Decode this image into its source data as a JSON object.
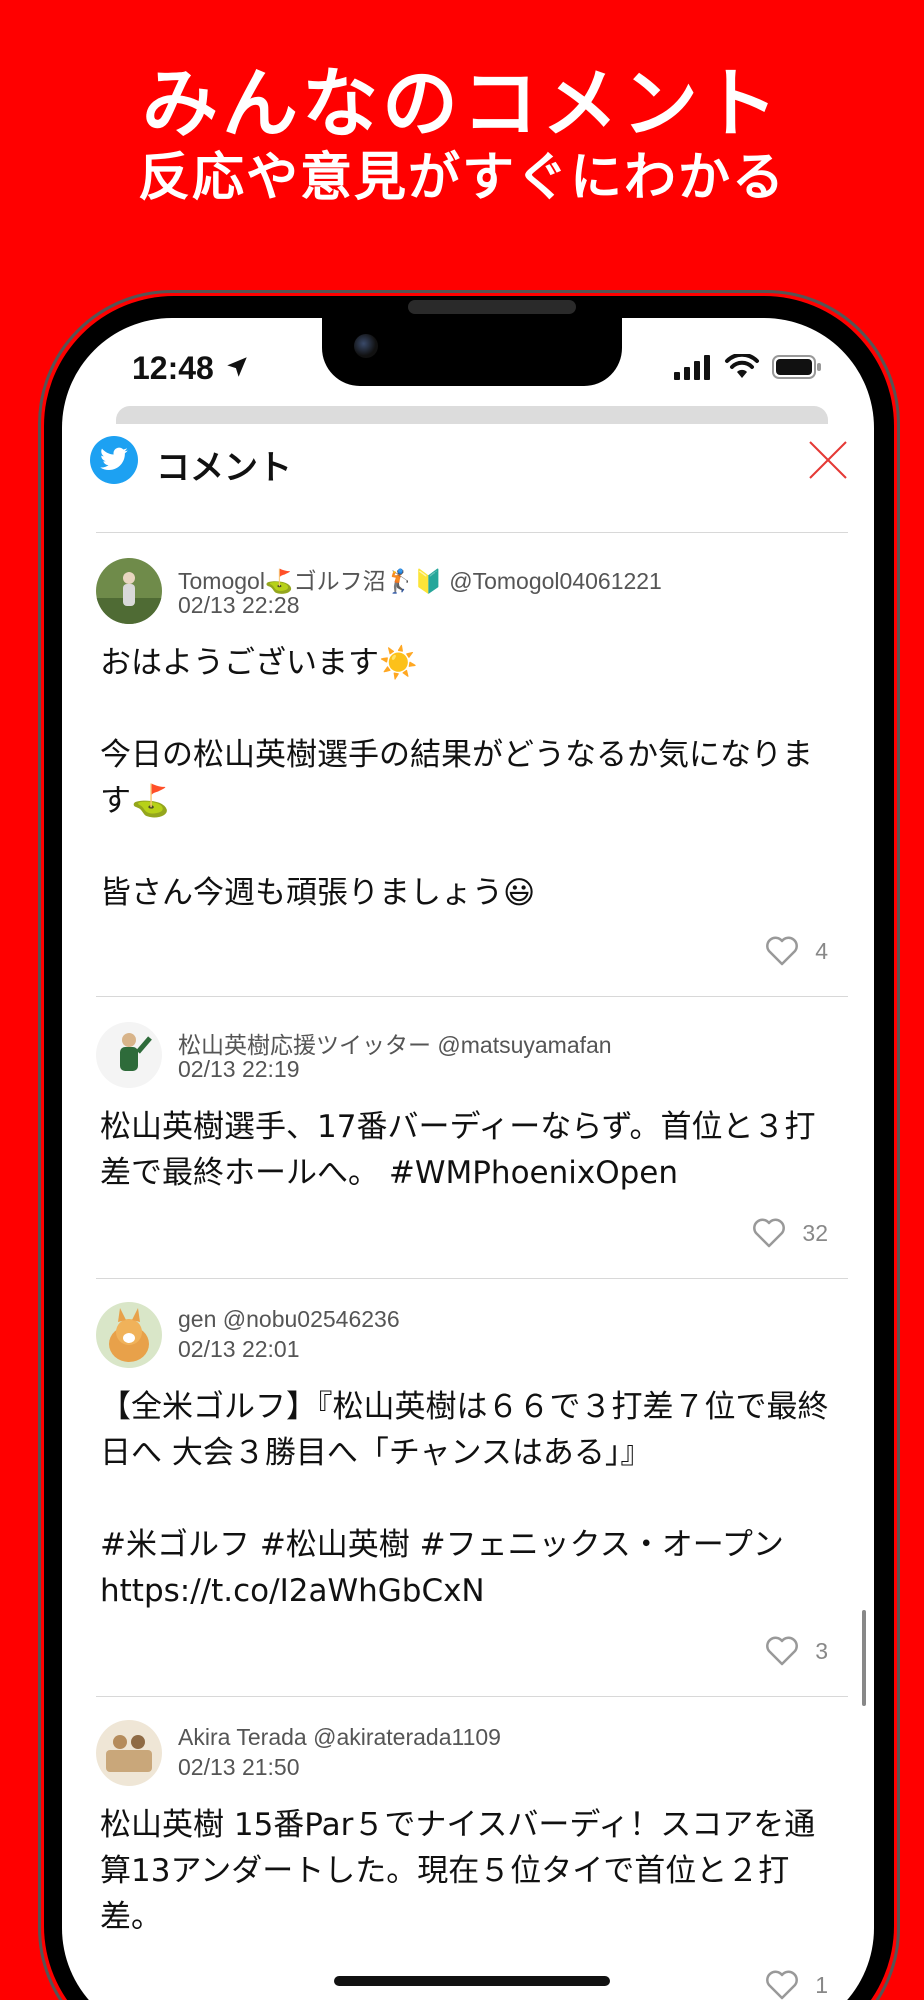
{
  "promo": {
    "title": "みんなのコメント",
    "subtitle": "反応や意見がすぐにわかる"
  },
  "status_bar": {
    "time": "12:48"
  },
  "modal": {
    "title": "コメント"
  },
  "comments": [
    {
      "user": "Tomogol⛳ゴルフ沼🏌🔰 @Tomogol04061221",
      "date": "02/13 22:28",
      "text": "おはようございます☀️\n\n今日の松山英樹選手の結果がどうなるか気になります⛳\n\n皆さん今週も頑張りましょう😃",
      "likes": "4"
    },
    {
      "user": "松山英樹応援ツイッター @matsuyamafan",
      "date": "02/13 22:19",
      "text": "松山英樹選手、17番バーディーならず。首位と３打差で最終ホールへ。 #WMPhoenixOpen",
      "likes": "32"
    },
    {
      "user": "gen @nobu02546236",
      "date": "02/13 22:01",
      "text": "【全米ゴルフ】『松山英樹は６６で３打差７位で最終日へ 大会３勝目へ「チャンスはある」』\n\n#米ゴルフ #松山英樹 #フェニックス・オープン https://t.co/I2aWhGbCxN",
      "likes": "3"
    },
    {
      "user": "Akira Terada @akiraterada1109",
      "date": "02/13 21:50",
      "text": "松山英樹 15番Par５でナイスバーディ！スコアを通算13アンダートした。現在５位タイで首位と２打差。",
      "likes": "1"
    }
  ]
}
